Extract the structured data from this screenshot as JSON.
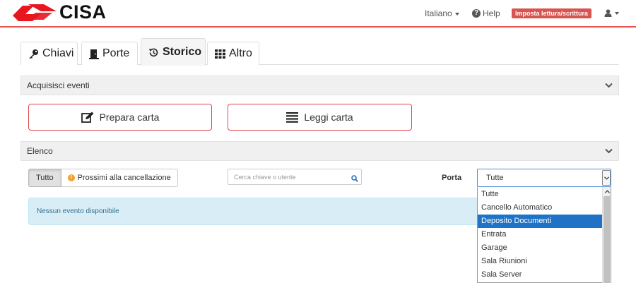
{
  "brand": {
    "name": "CISA",
    "color": "#e8161e"
  },
  "navbar": {
    "language": "Italiano",
    "help": "Help",
    "badge": "Imposta lettura/scrittura",
    "user_icon": "user-icon"
  },
  "tabs": [
    {
      "label": "Chiavi",
      "icon": "key-icon"
    },
    {
      "label": "Porte",
      "icon": "door-icon"
    },
    {
      "label": "Storico",
      "icon": "history-icon",
      "active": true
    },
    {
      "label": "Altro",
      "icon": "grid-icon"
    }
  ],
  "acquire_panel": {
    "title": "Acquisisci eventi",
    "prepare_button": "Prepara carta",
    "read_button": "Leggi carta"
  },
  "list_panel": {
    "title": "Elenco",
    "filter_all": "Tutto",
    "filter_upcoming": "Prossimi alla cancellazione",
    "search_placeholder": "Cerca chiave o utente",
    "porta_label": "Porta",
    "porta_selected": "Tutte",
    "empty_message": "Nessun evento disponibile"
  },
  "porta_options": [
    "Tutte",
    "Cancello Automatico",
    "Deposito Documenti",
    "Entrata",
    "Garage",
    "Sala Riunioni",
    "Sala Server"
  ],
  "porta_highlighted": "Deposito Documenti",
  "colors": {
    "accent_red": "#e8554e",
    "badge_red": "#d9534f",
    "alert_bg": "#d9edf7",
    "alert_text": "#31708f",
    "select_highlight": "#1e73c7"
  }
}
